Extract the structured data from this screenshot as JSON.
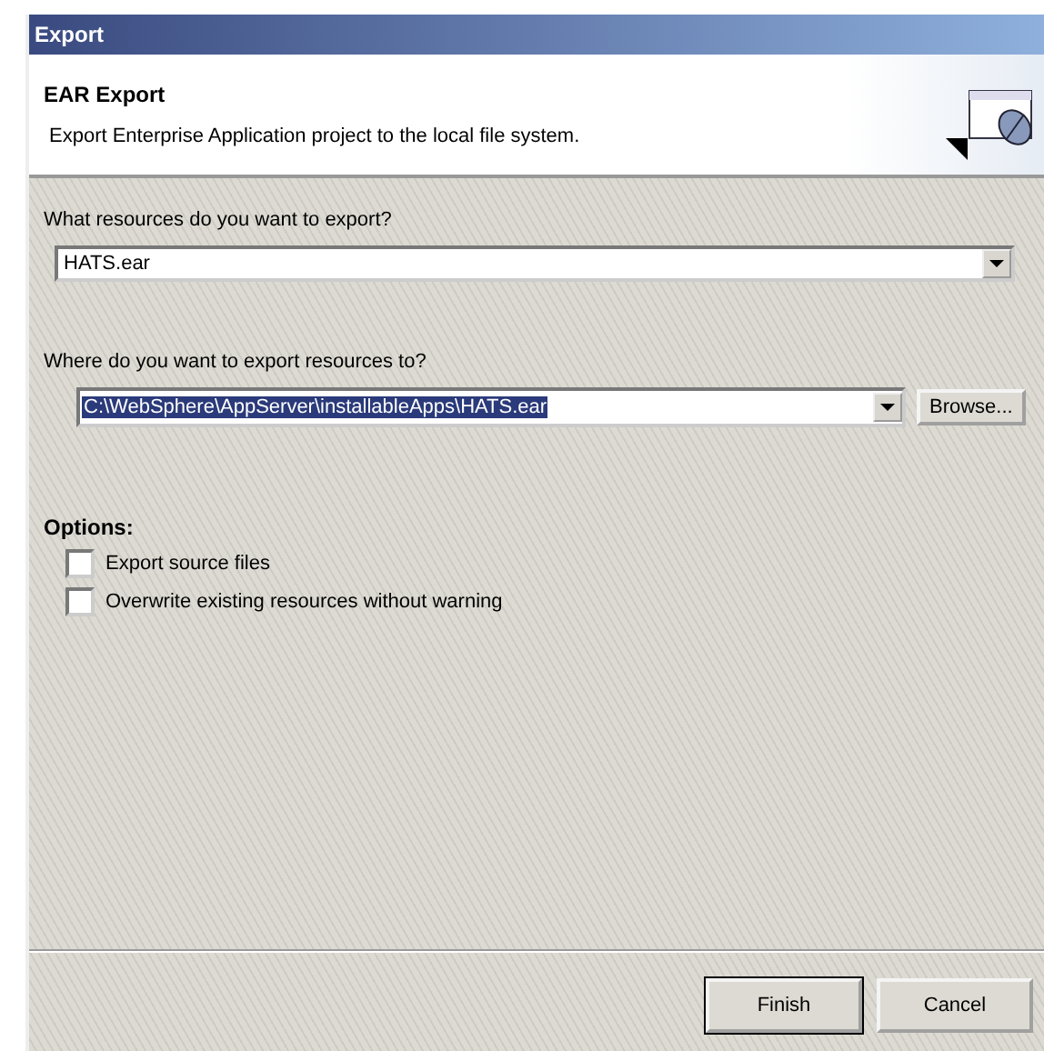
{
  "window": {
    "title": "Export"
  },
  "header": {
    "title": "EAR Export",
    "description": "Export Enterprise Application project to the local file system."
  },
  "resource": {
    "label": "What resources do you want to export?",
    "value": "HATS.ear"
  },
  "destination": {
    "label": "Where do you want to export resources to?",
    "value": "C:\\WebSphere\\AppServer\\installableApps\\HATS.ear",
    "selected": true,
    "browse": "Browse..."
  },
  "options": {
    "title": "Options:",
    "items": [
      {
        "label": "Export source files",
        "checked": false
      },
      {
        "label": "Overwrite existing resources without warning",
        "checked": false
      }
    ]
  },
  "buttons": [
    {
      "label": "Finish",
      "default": true
    },
    {
      "label": "Cancel",
      "default": false
    }
  ]
}
